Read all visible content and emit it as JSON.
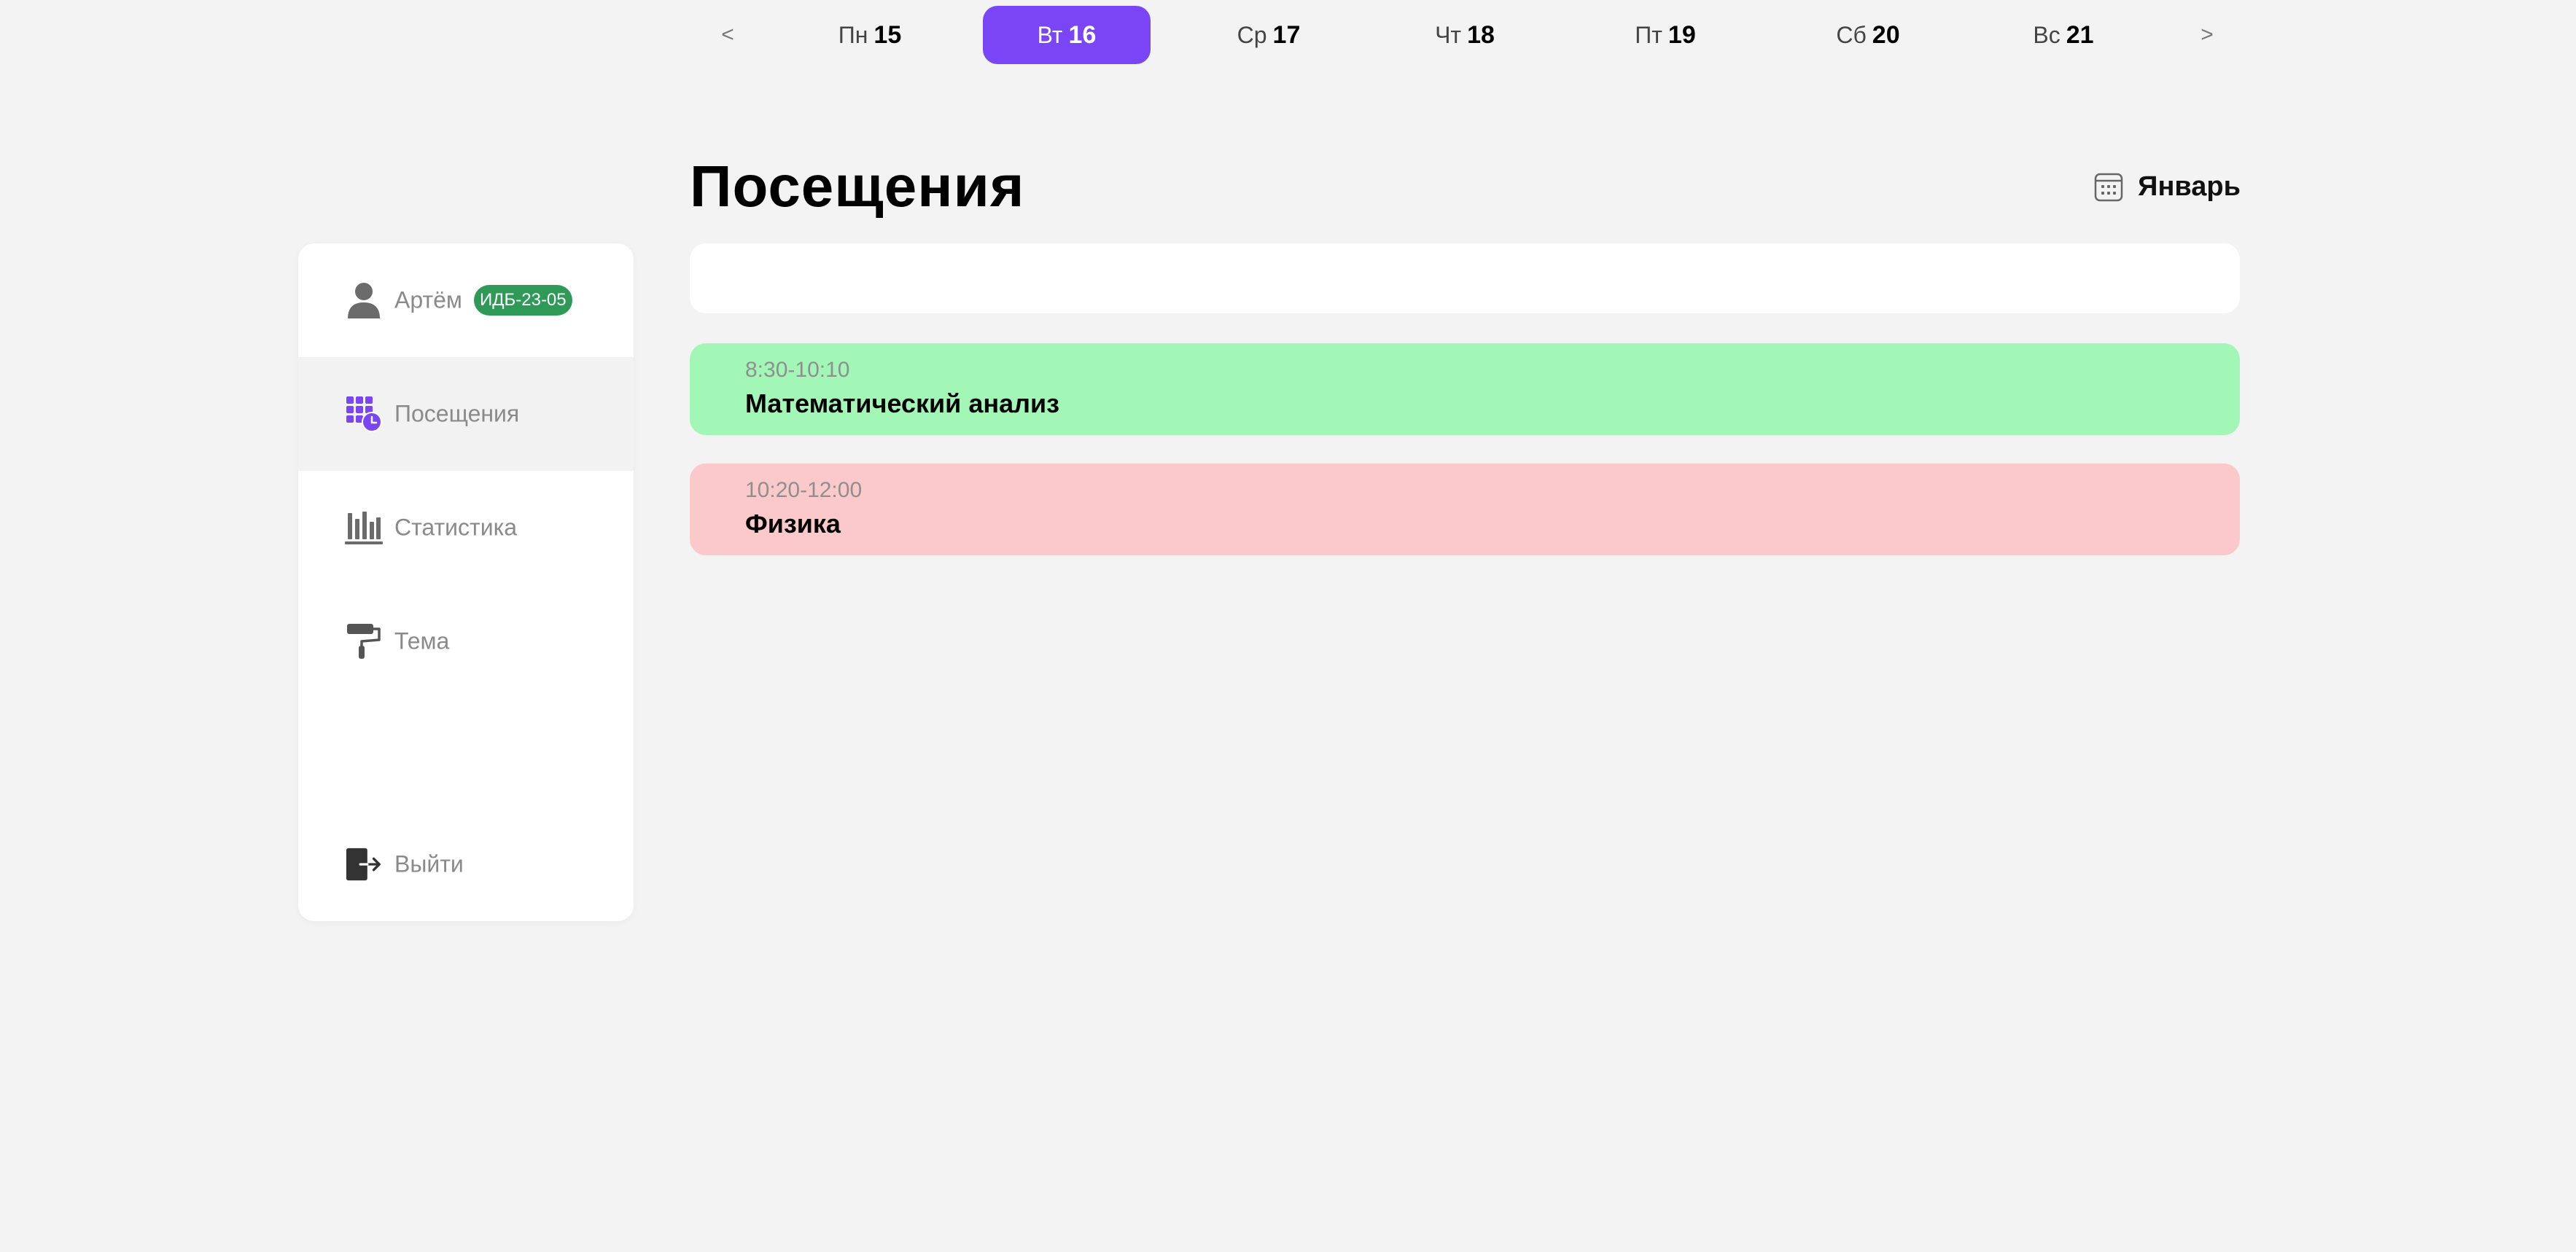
{
  "header": {
    "title": "Посещения",
    "month": "Январь"
  },
  "sidebar": {
    "user": {
      "name": "Артём",
      "group": "ИДБ-23-05",
      "group_color": "#2f9a57"
    },
    "items": [
      {
        "label": "Посещения",
        "icon": "attendance-icon",
        "active": true
      },
      {
        "label": "Статистика",
        "icon": "bar-chart-icon",
        "active": false
      },
      {
        "label": "Тема",
        "icon": "paint-roller-icon",
        "active": false
      }
    ],
    "logout": {
      "label": "Выйти",
      "icon": "logout-icon"
    }
  },
  "week": {
    "prev": "<",
    "next": ">",
    "days": [
      {
        "name": "Пн",
        "num": "15"
      },
      {
        "name": "Вт",
        "num": "16",
        "selected": true
      },
      {
        "name": "Ср",
        "num": "17"
      },
      {
        "name": "Чт",
        "num": "18"
      },
      {
        "name": "Пт",
        "num": "19"
      },
      {
        "name": "Сб",
        "num": "20"
      },
      {
        "name": "Вс",
        "num": "21"
      }
    ],
    "accent": "#7a45f5"
  },
  "lessons": [
    {
      "time": "8:30-10:10",
      "subject": "Математический анализ",
      "status": "attended",
      "color": "#a3f7b6"
    },
    {
      "time": "10:20-12:00",
      "subject": "Физика",
      "status": "missed",
      "color": "#fbc9c9"
    }
  ]
}
